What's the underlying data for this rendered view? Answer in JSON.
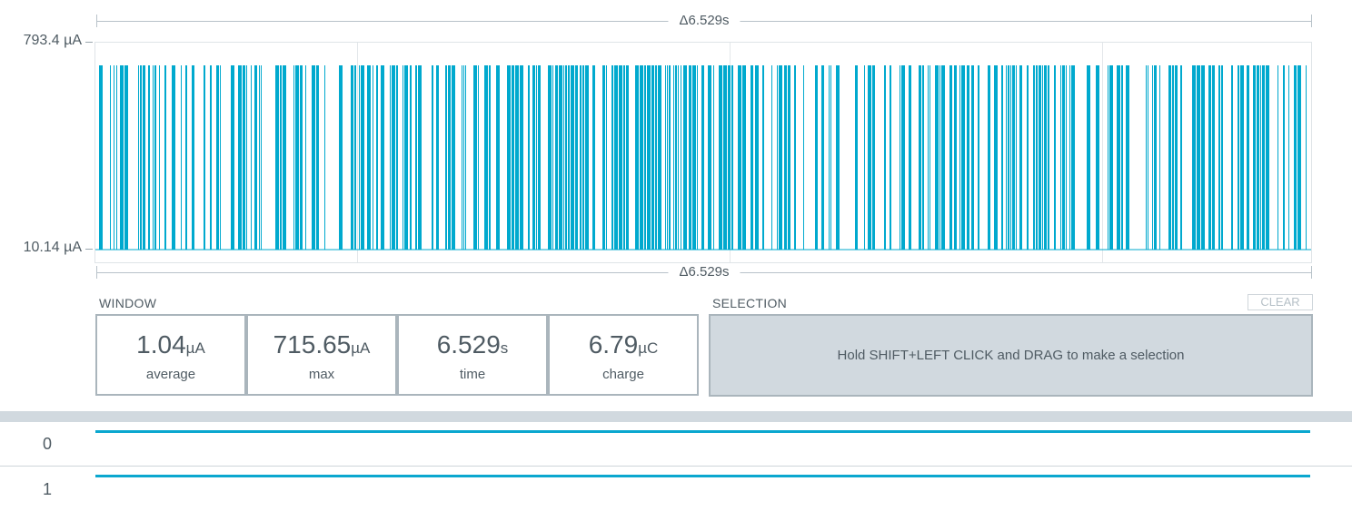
{
  "top_ruler": {
    "label": "Δ6.529s"
  },
  "bottom_ruler": {
    "label": "Δ6.529s"
  },
  "y_axis": {
    "max_label": "793.4 µA",
    "min_label": "10.14 µA"
  },
  "chart_data": {
    "type": "line",
    "title": "",
    "ylim": [
      10.14,
      793.4
    ],
    "y_unit": "µA",
    "duration_s": 6.529,
    "high_level_uA": 715.65,
    "low_level_uA": 10.14,
    "color": "#00a9ce",
    "grid": true
  },
  "window": {
    "title": "WINDOW",
    "stats": [
      {
        "value": "1.04",
        "unit": "µA",
        "caption": "average"
      },
      {
        "value": "715.65",
        "unit": "µA",
        "caption": "max"
      },
      {
        "value": "6.529",
        "unit": "s",
        "caption": "time"
      },
      {
        "value": "6.79",
        "unit": "µC",
        "caption": "charge"
      }
    ]
  },
  "selection": {
    "title": "SELECTION",
    "clear_label": "CLEAR",
    "hint": "Hold SHIFT+LEFT CLICK and DRAG to make a selection"
  },
  "digital_channels": [
    {
      "label": "0"
    },
    {
      "label": "1"
    }
  ],
  "colors": {
    "trace": "#00a9ce",
    "panel_border": "#aab5bc",
    "selection_bg": "#d1d9df"
  }
}
